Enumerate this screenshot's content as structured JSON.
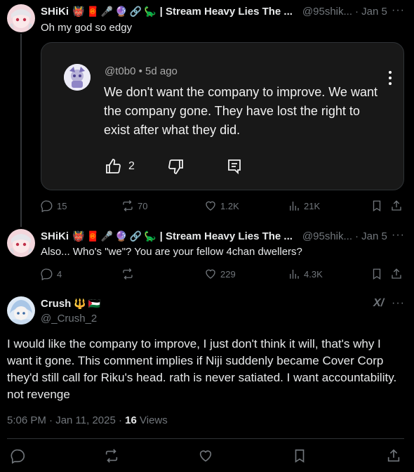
{
  "reply1": {
    "name": "SHiKi",
    "badges": [
      "👹",
      "🧧",
      "🎤",
      "🔮",
      "🔗",
      "🦕"
    ],
    "title": "| Stream Heavy Lies The ...",
    "handle": "@95shik...",
    "date": "· Jan 5",
    "text": "Oh my god so edgy",
    "embed": {
      "handle": "@t0b0",
      "time": "• 5d ago",
      "text": "We don't want the company to improve. We want the company gone. They have lost the right to exist after what they did.",
      "likes": "2"
    },
    "stats": {
      "replies": "15",
      "reposts": "70",
      "likes": "1.2K",
      "views": "21K"
    }
  },
  "reply2": {
    "name": "SHiKi",
    "badges": [
      "👹",
      "🧧",
      "🎤",
      "🔮",
      "🔗",
      "🦕"
    ],
    "title": "| Stream Heavy Lies The ...",
    "handle": "@95shik...",
    "date": "· Jan 5",
    "text": "Also... Who's \"we\"? You are your fellow 4chan dwellers?",
    "stats": {
      "replies": "4",
      "reposts": "",
      "likes": "229",
      "views": "4.3K"
    }
  },
  "main": {
    "name": "Crush",
    "badges": [
      "🔱",
      "🇵🇸"
    ],
    "handle": "@_Crush_2",
    "text": "I would like the company to improve, I just don't think it will, that's why I want it gone.  This comment implies if Niji suddenly became Cover Corp they'd still call for Riku's head.  rath is never satiated. I want accountability. not revenge",
    "timestamp": "5:06 PM · Jan 11, 2025 ·",
    "views_count": "16",
    "views_label": "Views",
    "grok_label": "X/"
  },
  "colors": {
    "background": "#000000",
    "muted": "#71767b",
    "text": "#e7e9ea",
    "card": "#181818"
  }
}
